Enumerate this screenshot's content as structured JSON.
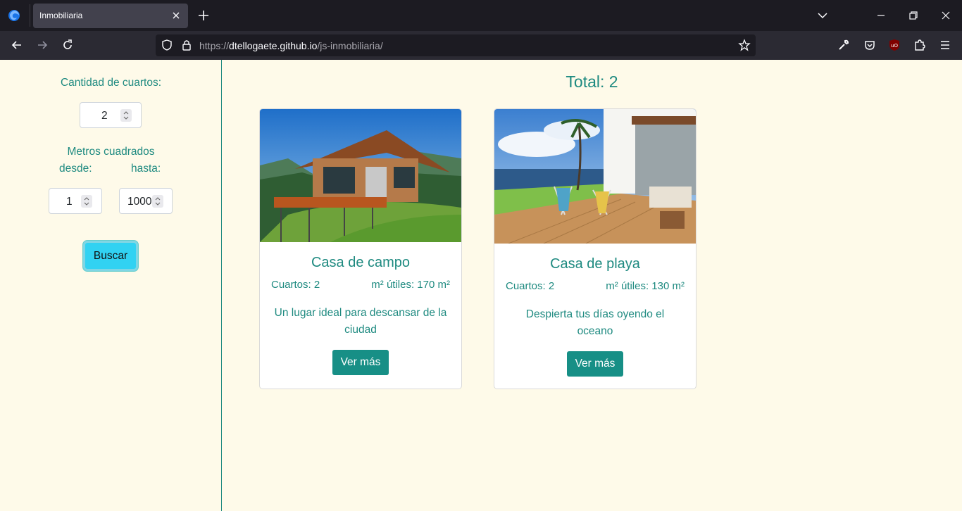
{
  "browser": {
    "tab_title": "Inmobiliaria",
    "url_prefix": "https://",
    "url_domain": "dtellogaete.github.io",
    "url_path": "/js-inmobiliaria/"
  },
  "sidebar": {
    "rooms_label": "Cantidad de cuartos:",
    "rooms_value": "2",
    "meters_label": "Metros cuadrados",
    "from_label": "desde:",
    "to_label": "hasta:",
    "from_value": "1",
    "to_value": "1000",
    "search_button": "Buscar"
  },
  "main": {
    "total_label": "Total: 2",
    "cards": [
      {
        "title": "Casa de campo",
        "rooms": "Cuartos: 2",
        "area": "m² útiles: 170 m²",
        "description": "Un lugar ideal para descansar de la ciudad",
        "button": "Ver más"
      },
      {
        "title": "Casa de playa",
        "rooms": "Cuartos: 2",
        "area": "m² útiles: 130 m²",
        "description": "Despierta tus días oyendo el oceano",
        "button": "Ver más"
      }
    ]
  },
  "colors": {
    "accent": "#1e8a80",
    "page_bg": "#fefae9",
    "button_teal": "#178f86",
    "search_button": "#31d2f2"
  }
}
